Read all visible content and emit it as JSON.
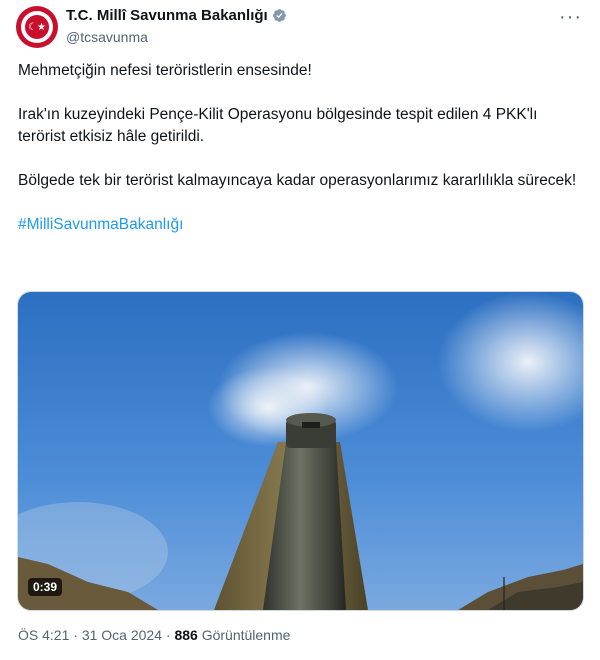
{
  "account": {
    "display_name": "T.C. Millî Savunma Bakanlığı",
    "handle": "@tcsavunma",
    "verified": true,
    "avatar_icon": "ministry-emblem-icon",
    "avatar_color": "#c8102e"
  },
  "more_icon": "more-options-icon",
  "tweet": {
    "line1": "Mehmetçiğin nefesi teröristlerin ensesinde!",
    "line2": "Irak'ın kuzeyindeki Pençe-Kilit Operasyonu bölgesinde tespit edilen 4 PKK'lı terörist etkisiz hâle getirildi.",
    "line3": "Bölgede tek bir terörist kalmayıncaya kadar operasyonlarımız kararlılıkla sürecek!",
    "hashtag": "#MilliSavunmaBakanlığı",
    "hashtag_color": "#1d9bf0"
  },
  "media": {
    "duration": "0:39"
  },
  "meta": {
    "time": "ÖS 4:21",
    "separator": "·",
    "date": "31 Oca 2024",
    "views": "886",
    "views_label": "Görüntülenme"
  }
}
